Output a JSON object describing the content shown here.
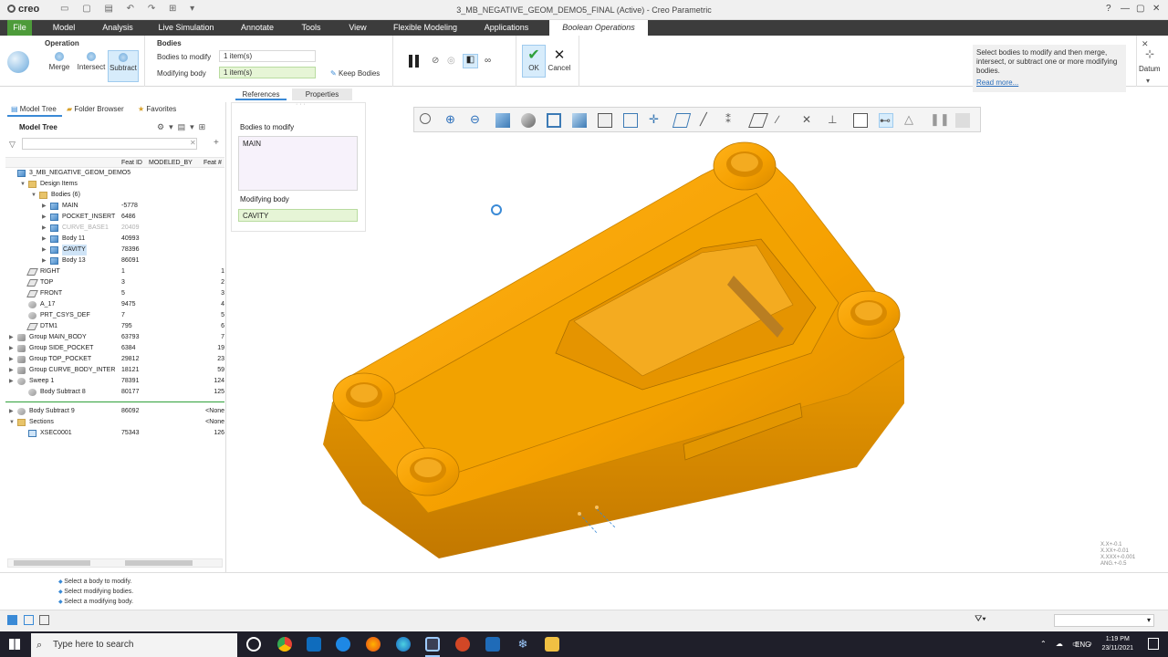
{
  "window": {
    "app_logo": "creo",
    "title": "3_MB_NEGATIVE_GEOM_DEMO5_FINAL (Active) - Creo Parametric"
  },
  "menu": {
    "items": [
      "File",
      "Model",
      "Analysis",
      "Live Simulation",
      "Annotate",
      "Tools",
      "View",
      "Flexible Modeling",
      "Applications",
      "Boolean Operations"
    ]
  },
  "ribbon": {
    "operation_label": "Operation",
    "merge_label": "Merge",
    "intersect_label": "Intersect",
    "subtract_label": "Subtract",
    "bodies_label": "Bodies",
    "bodies_to_modify_label": "Bodies to modify",
    "bodies_to_modify_value": "1 item(s)",
    "modifying_body_label": "Modifying body",
    "modifying_body_value": "1 item(s)",
    "keep_bodies_label": "Keep Bodies",
    "ok_label": "OK",
    "cancel_label": "Cancel",
    "help_text": "Select bodies to modify and then merge, intersect, or subtract one or more modifying bodies.",
    "help_link": "Read more...",
    "datum_label": "Datum",
    "references_tab": "References",
    "properties_tab": "Properties"
  },
  "navigator": {
    "tabs": [
      "Model Tree",
      "Folder Browser",
      "Favorites"
    ],
    "title": "Model Tree",
    "columns": [
      "Feat ID",
      "MODELED_BY",
      "Feat #"
    ],
    "rows": [
      {
        "name": "3_MB_NEGATIVE_GEOM_DEMO5",
        "id": "",
        "no": ""
      },
      {
        "name": "Design Items",
        "id": "",
        "no": ""
      },
      {
        "name": "Bodies (6)",
        "id": "",
        "no": ""
      },
      {
        "name": "MAIN",
        "id": "-5778",
        "no": ""
      },
      {
        "name": "POCKET_INSERT",
        "id": "6486",
        "no": ""
      },
      {
        "name": "CURVE_BASE1",
        "id": "20409",
        "no": ""
      },
      {
        "name": "Body 11",
        "id": "40993",
        "no": ""
      },
      {
        "name": "CAVITY",
        "id": "78396",
        "no": ""
      },
      {
        "name": "Body 13",
        "id": "86091",
        "no": ""
      },
      {
        "name": "RIGHT",
        "id": "1",
        "no": "1"
      },
      {
        "name": "TOP",
        "id": "3",
        "no": "2"
      },
      {
        "name": "FRONT",
        "id": "5",
        "no": "3"
      },
      {
        "name": "A_17",
        "id": "9475",
        "no": "4"
      },
      {
        "name": "PRT_CSYS_DEF",
        "id": "7",
        "no": "5"
      },
      {
        "name": "DTM1",
        "id": "795",
        "no": "6"
      },
      {
        "name": "Group MAIN_BODY",
        "id": "63793",
        "no": "7"
      },
      {
        "name": "Group SIDE_POCKET",
        "id": "6384",
        "no": "19"
      },
      {
        "name": "Group TOP_POCKET",
        "id": "29812",
        "no": "23"
      },
      {
        "name": "Group CURVE_BODY_INTER",
        "id": "18121",
        "no": "59"
      },
      {
        "name": "Sweep 1",
        "id": "78391",
        "no": "124"
      },
      {
        "name": "Body Subtract 8",
        "id": "80177",
        "no": "125"
      },
      {
        "name": "Body Subtract 9",
        "id": "86092",
        "no": "<None"
      },
      {
        "name": "Sections",
        "id": "",
        "no": "<None"
      },
      {
        "name": "XSEC0001",
        "id": "75343",
        "no": "126"
      }
    ]
  },
  "references": {
    "bodies_to_modify_label": "Bodies to modify",
    "bodies_to_modify_item": "MAIN",
    "modifying_body_label": "Modifying body",
    "modifying_body_item": "CAVITY"
  },
  "messages": [
    "Select a body to modify.",
    "Select modifying bodies.",
    "Select a modifying body."
  ],
  "viewport": {
    "coord_readout": [
      "X.X+-0.1",
      "X.XX+-0.01",
      "X.XXX+-0.001",
      "ANG.+-0.5"
    ],
    "model_color": "#f5a000"
  },
  "taskbar": {
    "search_placeholder": "Type here to search",
    "language": "ENG",
    "time": "1:19 PM",
    "date": "23/11/2021"
  }
}
